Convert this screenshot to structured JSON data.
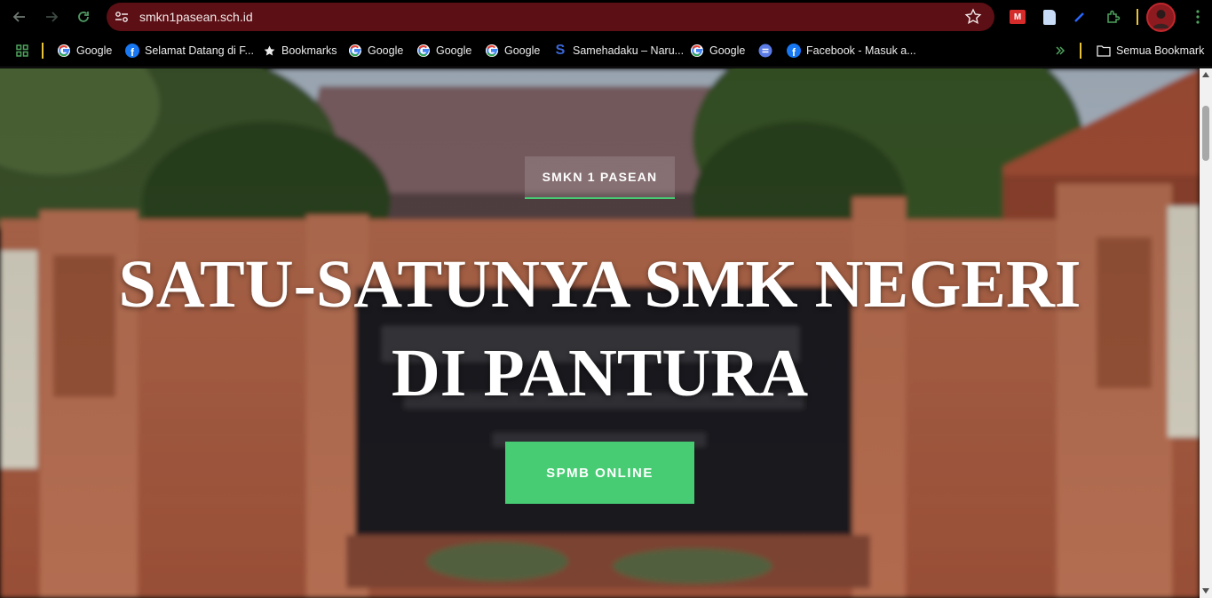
{
  "browser": {
    "url": "smkn1pasean.sch.id",
    "colors": {
      "omnibox_bg": "#5c0f14",
      "accent_green": "#47cc74"
    }
  },
  "bookmarks": {
    "items": [
      {
        "label": "Google",
        "icon": "google-icon"
      },
      {
        "label": "Selamat Datang di F...",
        "icon": "facebook-icon"
      },
      {
        "label": "Bookmarks",
        "icon": "star-icon"
      },
      {
        "label": "Google",
        "icon": "google-icon"
      },
      {
        "label": "Google",
        "icon": "google-icon"
      },
      {
        "label": "Google",
        "icon": "google-icon"
      },
      {
        "label": "Samehadaku – Naru...",
        "icon": "samehadaku-icon"
      },
      {
        "label": "Google",
        "icon": "google-icon"
      },
      {
        "label": "",
        "icon": "extension-bookmark-icon"
      },
      {
        "label": "Facebook - Masuk a...",
        "icon": "facebook-icon"
      }
    ],
    "all_bookmarks_label": "Semua Bookmark"
  },
  "hero": {
    "kicker": "SMKN 1 PASEAN",
    "headline_line1": "SATU-SATUNYA SMK NEGERI",
    "headline_line2": "DI PANTURA",
    "cta_label": "SPMB ONLINE"
  }
}
